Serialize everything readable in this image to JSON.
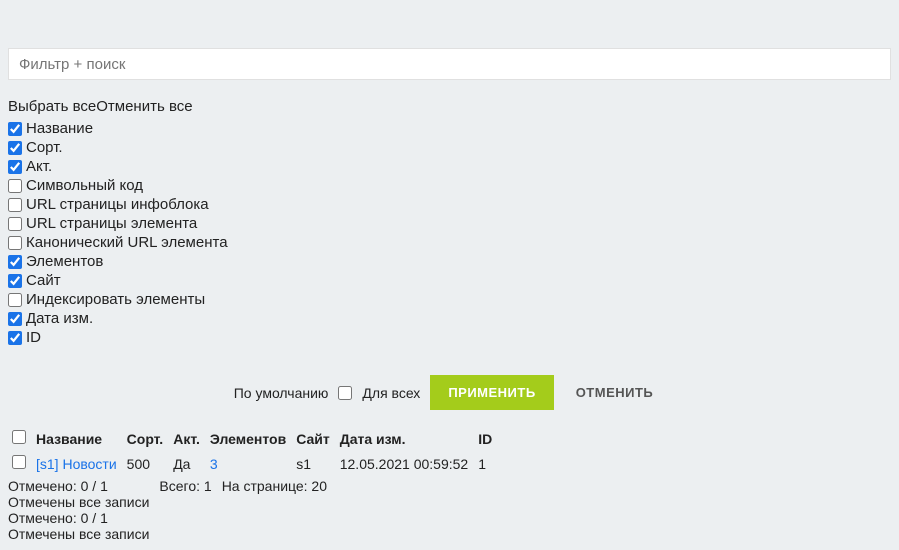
{
  "filter": {
    "placeholder": "Фильтр + поиск"
  },
  "selectAll": "Выбрать все",
  "deselectAll": "Отменить все",
  "columns": [
    {
      "label": "Название",
      "checked": true
    },
    {
      "label": "Сорт.",
      "checked": true
    },
    {
      "label": "Акт.",
      "checked": true
    },
    {
      "label": "Символьный код",
      "checked": false
    },
    {
      "label": "URL страницы инфоблока",
      "checked": false
    },
    {
      "label": "URL страницы элемента",
      "checked": false
    },
    {
      "label": "Канонический URL элемента",
      "checked": false
    },
    {
      "label": "Элементов",
      "checked": true
    },
    {
      "label": "Сайт",
      "checked": true
    },
    {
      "label": "Индексировать элементы",
      "checked": false
    },
    {
      "label": "Дата изм.",
      "checked": true
    },
    {
      "label": "ID",
      "checked": true
    }
  ],
  "actions": {
    "default": "По умолчанию",
    "forAll": "Для всех",
    "apply": "Применить",
    "cancel": "Отменить"
  },
  "table": {
    "headers": {
      "name": "Название",
      "sort": "Сорт.",
      "active": "Акт.",
      "elements": "Элементов",
      "site": "Сайт",
      "modified": "Дата изм.",
      "id": "ID"
    },
    "row": {
      "name": "[s1] Новости",
      "sort": "500",
      "active": "Да",
      "elements": "3",
      "site": "s1",
      "modified": "12.05.2021 00:59:52",
      "id": "1"
    }
  },
  "footer": {
    "selected": "Отмечено: 0 / 1",
    "allSelected": "Отмечены все записи",
    "total": "Всего: 1",
    "perPage": "На странице: 20"
  }
}
